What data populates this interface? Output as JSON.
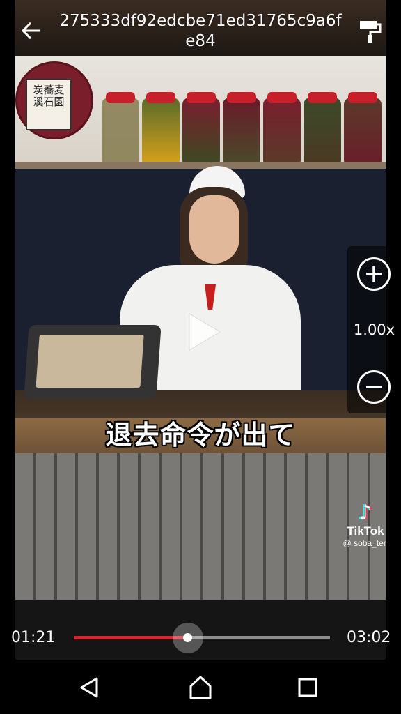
{
  "header": {
    "title": "275333df92edcbe71ed31765c9a6fe84",
    "back_icon": "arrow-left-icon",
    "paint_icon": "paint-roller-icon"
  },
  "video": {
    "sign_text": "炭蕎麦 溪石園",
    "subtitle": "退去命令が出て",
    "watermark": {
      "brand": "TikTok",
      "handle": "@ soba_ten"
    }
  },
  "zoom": {
    "level_label": "1.00x",
    "zoom_in_icon": "plus-circle-icon",
    "zoom_out_icon": "minus-circle-icon"
  },
  "player": {
    "current_time": "01:21",
    "total_time": "03:02",
    "progress": 0.445,
    "play_icon": "play-icon",
    "colors": {
      "progress": "#d9262f",
      "track": "#8c8c8c"
    }
  },
  "navigation": {
    "back_icon": "triangle-back-icon",
    "home_icon": "home-icon",
    "recents_icon": "square-recents-icon"
  }
}
